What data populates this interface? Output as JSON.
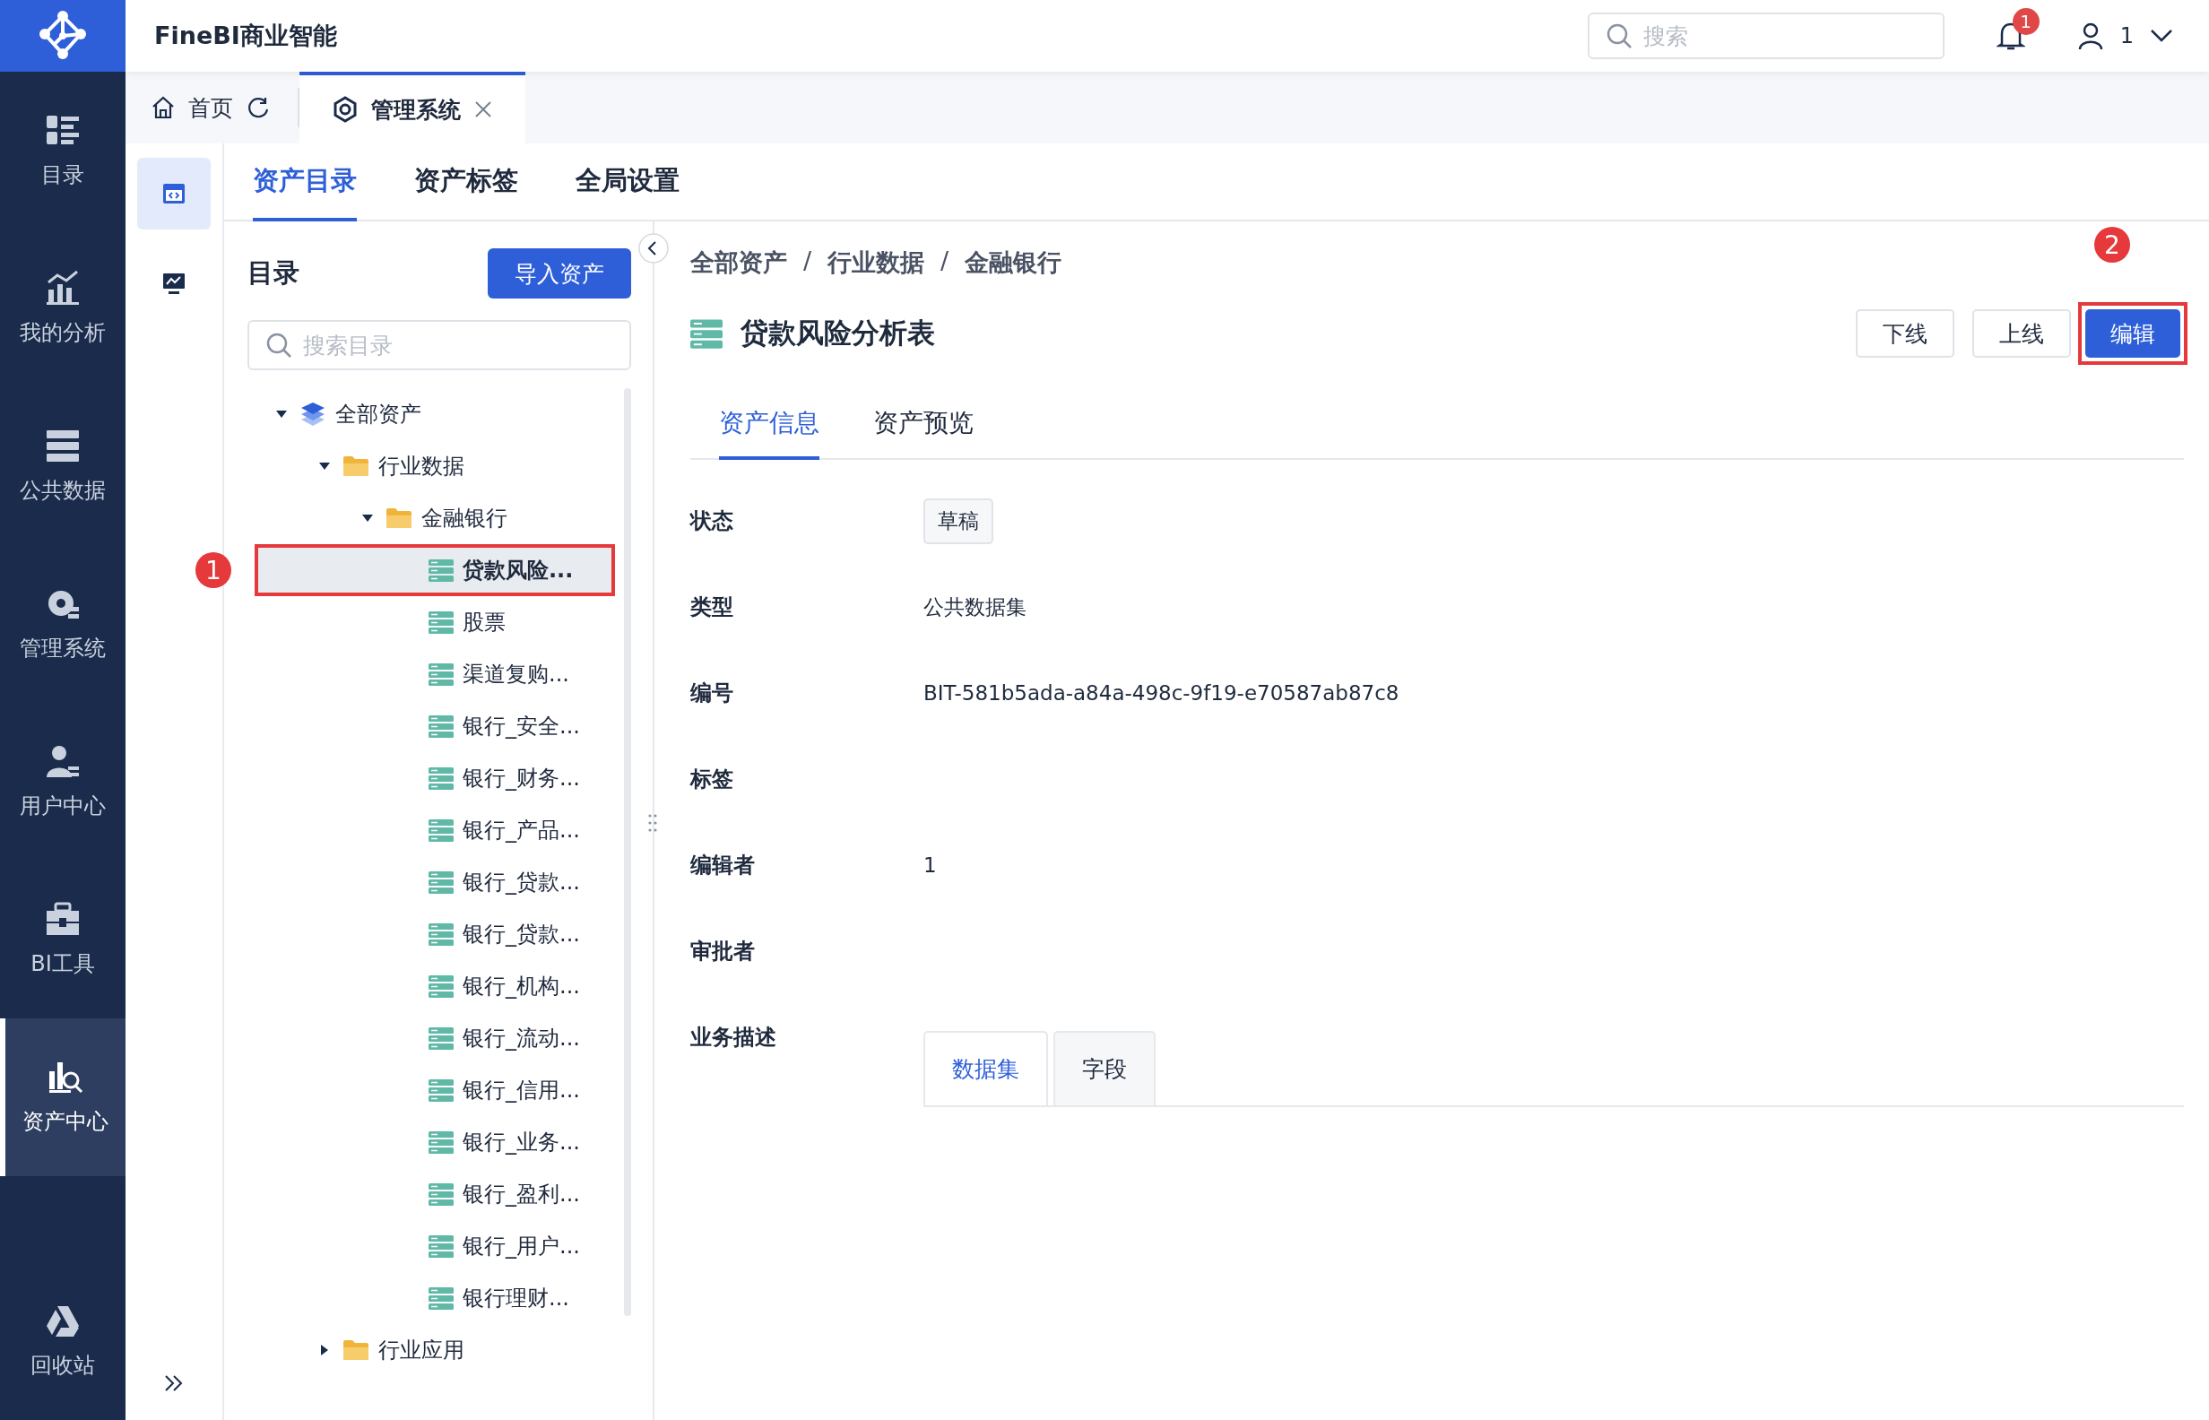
{
  "app": {
    "title": "FineBI商业智能"
  },
  "header": {
    "search": {
      "placeholder": "搜索"
    },
    "notification_count": "1",
    "user": "1"
  },
  "nav": {
    "items": [
      {
        "label": "目录",
        "selected": false
      },
      {
        "label": "我的分析",
        "selected": false
      },
      {
        "label": "公共数据",
        "selected": false
      },
      {
        "label": "管理系统",
        "selected": false
      },
      {
        "label": "用户中心",
        "selected": false
      },
      {
        "label": "BI工具",
        "selected": false
      },
      {
        "label": "资产中心",
        "selected": true
      }
    ],
    "bottom_item": {
      "label": "回收站"
    }
  },
  "page_tabs": [
    {
      "label": "首页",
      "kind": "home",
      "selected": false
    },
    {
      "label": "管理系统",
      "kind": "system",
      "selected": true
    }
  ],
  "side_tools": [
    {
      "selected": true
    },
    {
      "selected": false
    }
  ],
  "sub_tabs": [
    {
      "label": "资产目录",
      "selected": true
    },
    {
      "label": "资产标签",
      "selected": false
    },
    {
      "label": "全局设置",
      "selected": false
    }
  ],
  "catalog": {
    "title": "目录",
    "import_button": "导入资产",
    "search": {
      "placeholder": "搜索目录"
    },
    "tree": [
      {
        "label": "全部资产",
        "kind": "root",
        "expanded": true,
        "selected": false,
        "children": [
          {
            "label": "行业数据",
            "kind": "folder",
            "expanded": true,
            "selected": false,
            "children": [
              {
                "label": "金融银行",
                "kind": "folder",
                "expanded": true,
                "selected": false,
                "children": [
                  {
                    "label": "贷款风险...",
                    "kind": "dataset",
                    "selected": true,
                    "annotation": "1"
                  },
                  {
                    "label": "股票",
                    "kind": "dataset",
                    "selected": false
                  },
                  {
                    "label": "渠道复购...",
                    "kind": "dataset",
                    "selected": false
                  },
                  {
                    "label": "银行_安全...",
                    "kind": "dataset",
                    "selected": false
                  },
                  {
                    "label": "银行_财务...",
                    "kind": "dataset",
                    "selected": false
                  },
                  {
                    "label": "银行_产品...",
                    "kind": "dataset",
                    "selected": false
                  },
                  {
                    "label": "银行_贷款...",
                    "kind": "dataset",
                    "selected": false
                  },
                  {
                    "label": "银行_贷款...",
                    "kind": "dataset",
                    "selected": false
                  },
                  {
                    "label": "银行_机构...",
                    "kind": "dataset",
                    "selected": false
                  },
                  {
                    "label": "银行_流动...",
                    "kind": "dataset",
                    "selected": false
                  },
                  {
                    "label": "银行_信用...",
                    "kind": "dataset",
                    "selected": false
                  },
                  {
                    "label": "银行_业务...",
                    "kind": "dataset",
                    "selected": false
                  },
                  {
                    "label": "银行_盈利...",
                    "kind": "dataset",
                    "selected": false
                  },
                  {
                    "label": "银行_用户...",
                    "kind": "dataset",
                    "selected": false
                  },
                  {
                    "label": "银行理财...",
                    "kind": "dataset",
                    "selected": false
                  }
                ]
              }
            ]
          },
          {
            "label": "行业应用",
            "kind": "folder",
            "expanded": false,
            "selected": false
          }
        ]
      }
    ]
  },
  "detail": {
    "breadcrumb": [
      "全部资产",
      "行业数据",
      "金融银行"
    ],
    "breadcrumb_separator": "/",
    "title": "贷款风险分析表",
    "actions": [
      {
        "label": "下线",
        "kind": "plain"
      },
      {
        "label": "上线",
        "kind": "plain"
      },
      {
        "label": "编辑",
        "kind": "primary",
        "annotation": "2"
      }
    ],
    "tabs": [
      {
        "label": "资产信息",
        "selected": true
      },
      {
        "label": "资产预览",
        "selected": false
      }
    ],
    "fields": [
      {
        "label": "状态",
        "kind": "tag",
        "value": "草稿"
      },
      {
        "label": "类型",
        "kind": "text",
        "value": "公共数据集"
      },
      {
        "label": "编号",
        "kind": "text",
        "value": "BIT-581b5ada-a84a-498c-9f19-e70587ab87c8"
      },
      {
        "label": "标签",
        "kind": "text"
      },
      {
        "label": "编辑者",
        "kind": "text",
        "value": "1"
      },
      {
        "label": "审批者",
        "kind": "text"
      },
      {
        "label": "业务描述",
        "kind": "tabs",
        "tabs": [
          {
            "label": "数据集",
            "selected": true
          },
          {
            "label": "字段",
            "selected": false
          }
        ]
      }
    ]
  }
}
